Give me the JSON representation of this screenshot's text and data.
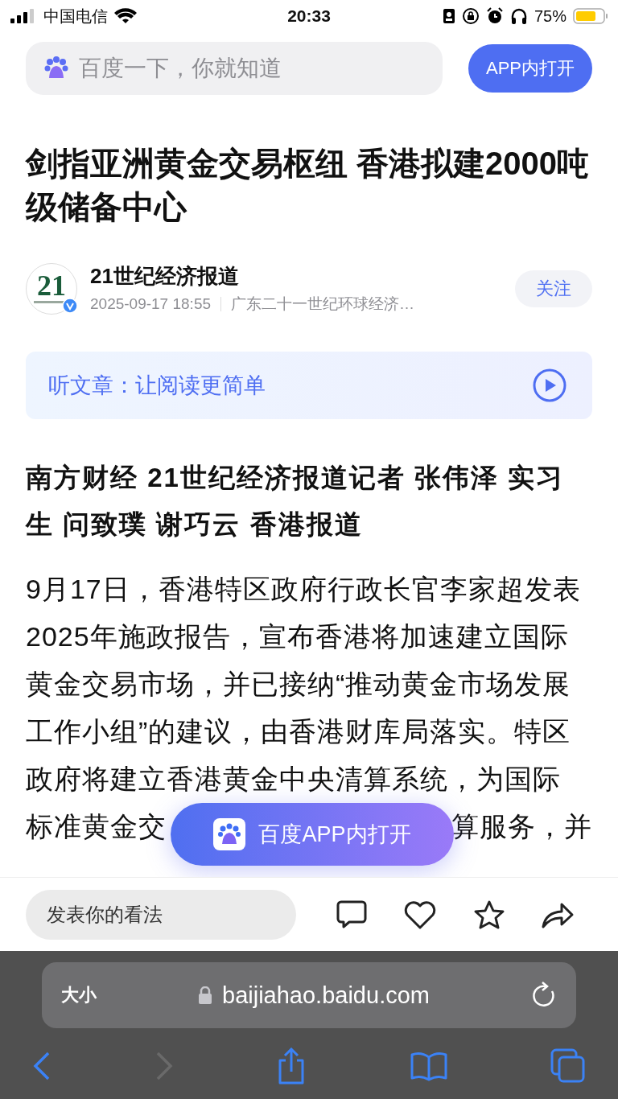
{
  "status_bar": {
    "carrier": "中国电信",
    "time": "20:33",
    "battery": "75%"
  },
  "header": {
    "search": {
      "placeholder": "百度一下，你就知道"
    },
    "open_button": "APP内打开"
  },
  "article": {
    "title": "剑指亚洲黄金交易枢纽 香港拟建2000吨级储备中心",
    "author": {
      "name": "21世纪经济报道",
      "logo_number": "21",
      "date": "2025-09-17 18:55",
      "source": "广东二十一世纪环球经济…",
      "follow": "关注",
      "verified": true
    },
    "listen": {
      "label": "听文章：让阅读更简单"
    },
    "byline": "南方财经 21世纪经济报道记者 张伟泽 实习生 问致璞 谢巧云 香港报道",
    "lines": [
      {
        "parts": [
          "9月17日，香港特区政府行政长官李家超发表"
        ]
      },
      {
        "parts": [
          "2025年施政报告，宣布香港将加速建立国际"
        ]
      },
      {
        "parts": [
          "黄金交易市场，并已接纳“推动黄金市场发展"
        ]
      },
      {
        "parts": [
          "工作小组”的建议，由香港财库局落实。特区"
        ]
      },
      {
        "parts": [
          "政府将建立香港黄金中央清算系统，为国际"
        ]
      },
      {
        "parts": [
          "标准黄金交",
          "算服务，并"
        ]
      }
    ]
  },
  "floating_button": "百度APP内打开",
  "comment_bar": {
    "placeholder": "发表你的看法"
  },
  "browser": {
    "text_size": "大小",
    "url": "baijiahao.baidu.com"
  }
}
